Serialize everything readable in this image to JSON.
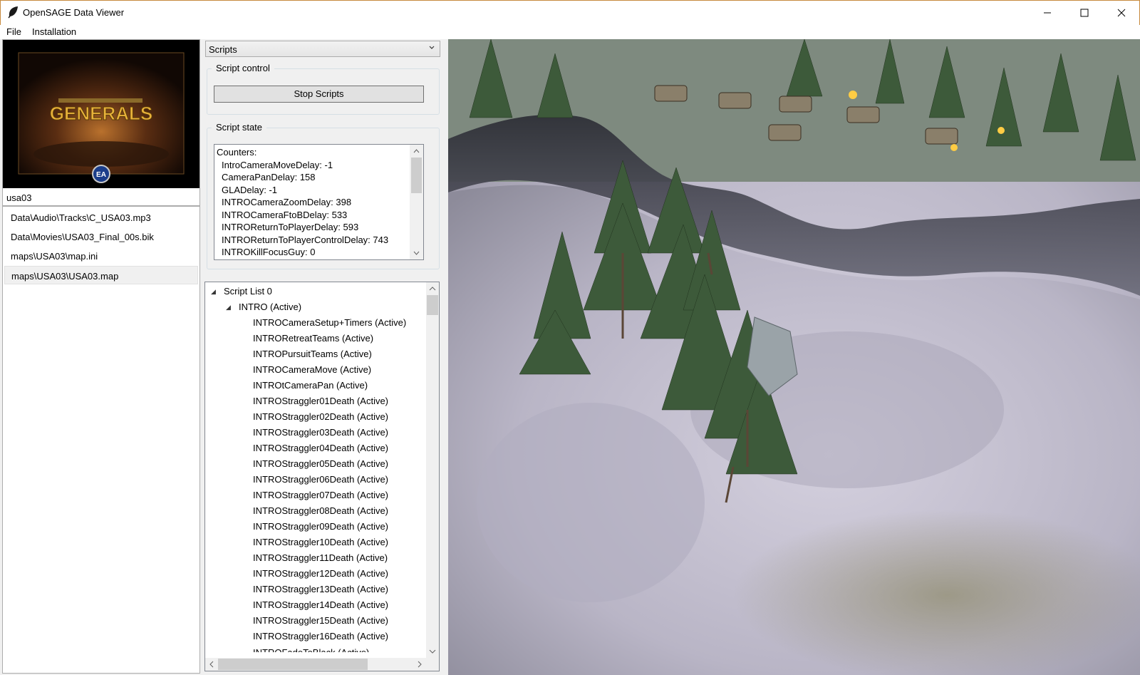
{
  "window": {
    "title": "OpenSAGE Data Viewer",
    "icon": "leaf-icon",
    "controls": [
      "minimize-icon",
      "maximize-icon",
      "close-icon"
    ]
  },
  "menu": {
    "file": "File",
    "installation": "Installation"
  },
  "left": {
    "thumbnail_text": "GENERALS",
    "thumbnail_badge": "EA",
    "search_value": "usa03",
    "files": [
      "Data\\Audio\\Tracks\\C_USA03.mp3",
      "Data\\Movies\\USA03_Final_00s.bik",
      "maps\\USA03\\map.ini",
      "maps\\USA03\\USA03.map"
    ],
    "selected_file": "maps\\USA03\\USA03.map"
  },
  "middle": {
    "dropdown_value": "Scripts",
    "script_control_label": "Script control",
    "stop_button": "Stop Scripts",
    "script_state_label": "Script state",
    "state_lines": [
      "Counters:",
      "IntroCameraMoveDelay: -1",
      "CameraPanDelay: 158",
      "GLADelay: -1",
      "INTROCameraZoomDelay: 398",
      "INTROCameraFtoBDelay: 533",
      "INTROReturnToPlayerDelay: 593",
      "INTROReturnToPlayerControlDelay: 743",
      "INTROKillFocusGuy: 0"
    ],
    "tree": {
      "root": "Script List 0",
      "group": "INTRO (Active)",
      "scripts": [
        "INTROCameraSetup+Timers (Active)",
        "INTRORetreatTeams (Active)",
        "INTROPursuitTeams (Active)",
        "INTROCameraMove (Active)",
        "INTROtCameraPan (Active)",
        "INTROStraggler01Death (Active)",
        "INTROStraggler02Death (Active)",
        "INTROStraggler03Death (Active)",
        "INTROStraggler04Death (Active)",
        "INTROStraggler05Death (Active)",
        "INTROStraggler06Death (Active)",
        "INTROStraggler07Death (Active)",
        "INTROStraggler08Death (Active)",
        "INTROStraggler09Death (Active)",
        "INTROStraggler10Death (Active)",
        "INTROStraggler11Death (Active)",
        "INTROStraggler12Death (Active)",
        "INTROStraggler13Death (Active)",
        "INTROStraggler14Death (Active)",
        "INTROStraggler15Death (Active)",
        "INTROStraggler16Death (Active)"
      ],
      "partial_last": "INTROFadeToBlack (Active)"
    }
  },
  "colors": {
    "window_border": "#c68a3e",
    "panel_bg": "#f0f0f0",
    "snow": "#c9c6d6",
    "tree": "#3d5a3a"
  }
}
